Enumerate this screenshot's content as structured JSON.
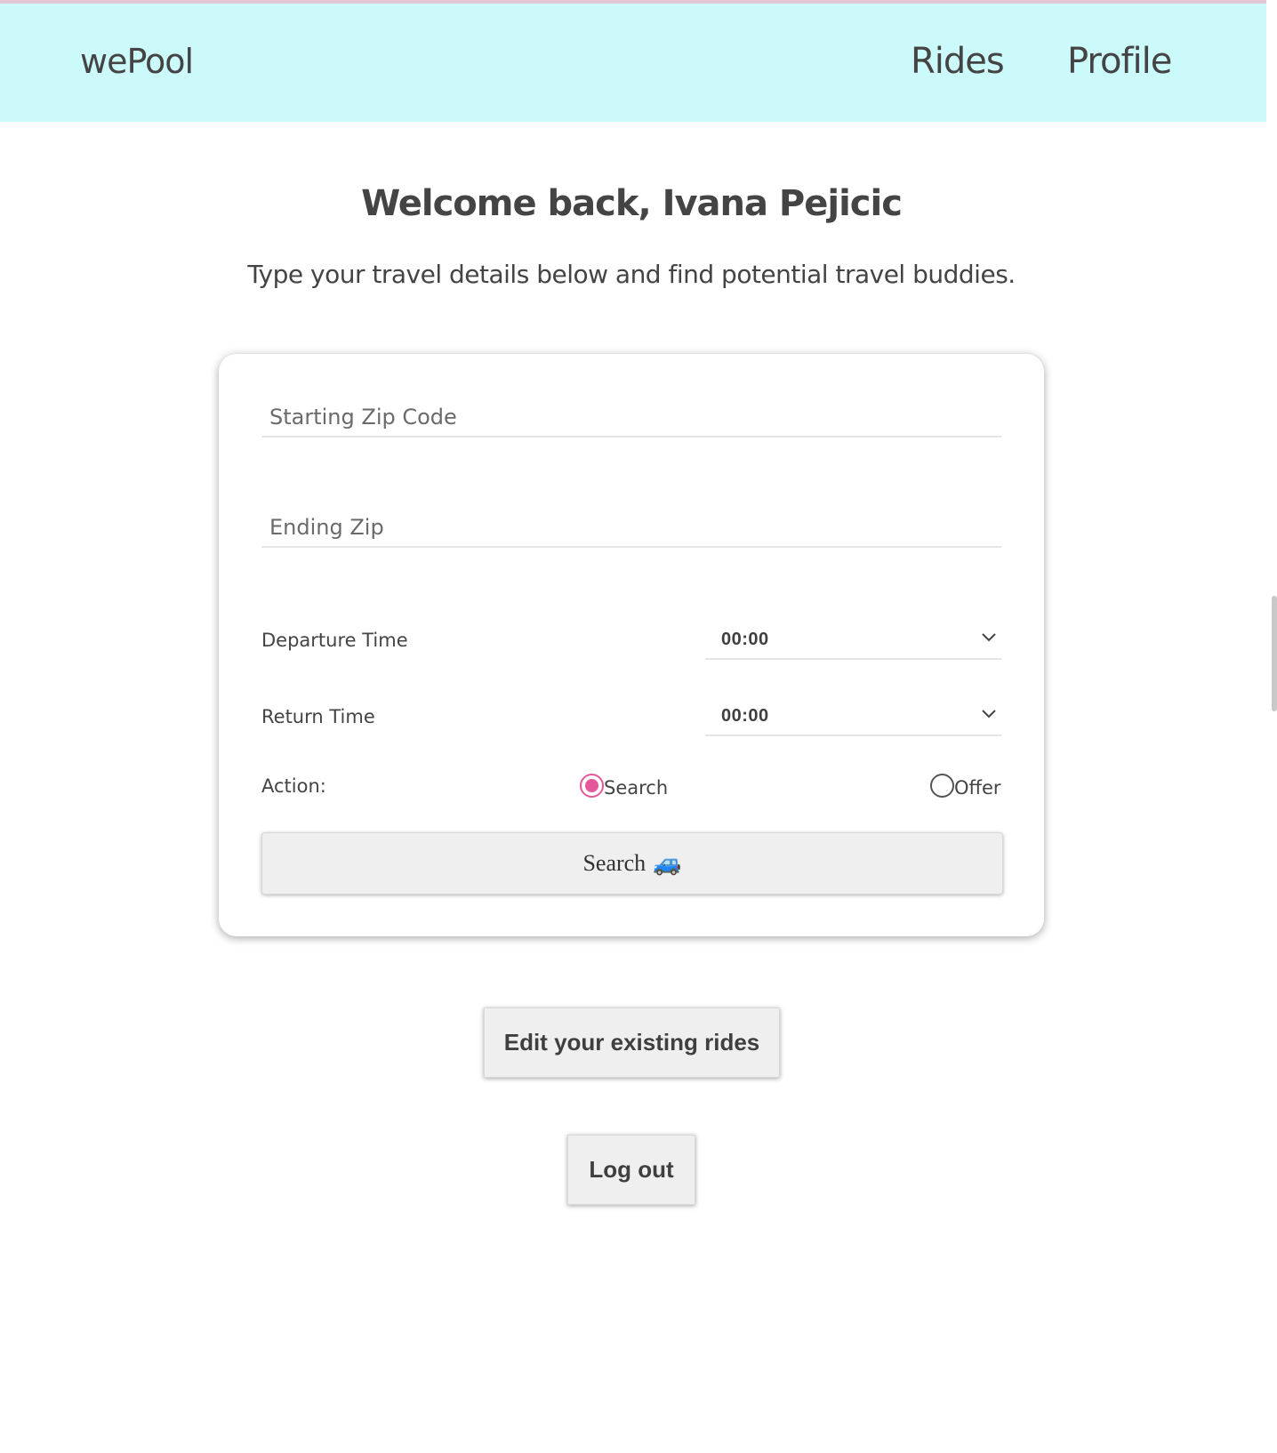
{
  "navbar": {
    "brand": "wePool",
    "links": [
      "Rides",
      "Profile"
    ]
  },
  "hero": {
    "welcome": "Welcome back, Ivana Pejicic",
    "subtitle": "Type your travel details below and find potential travel buddies."
  },
  "form": {
    "start_zip_placeholder": "Starting Zip Code",
    "end_zip_placeholder": "Ending Zip",
    "departure_label": "Departure Time",
    "departure_value": "00:00",
    "return_label": "Return Time",
    "return_value": "00:00",
    "action_label": "Action:",
    "action_options": [
      "Search",
      "Offer"
    ],
    "selected_action": "Search",
    "submit_label": "Search",
    "submit_icon": "🚙"
  },
  "actions": {
    "edit_rides": "Edit your existing rides",
    "logout": "Log out"
  },
  "colors": {
    "navbar_bg": "#ccf9f9",
    "radio_accent": "#e5589a"
  }
}
